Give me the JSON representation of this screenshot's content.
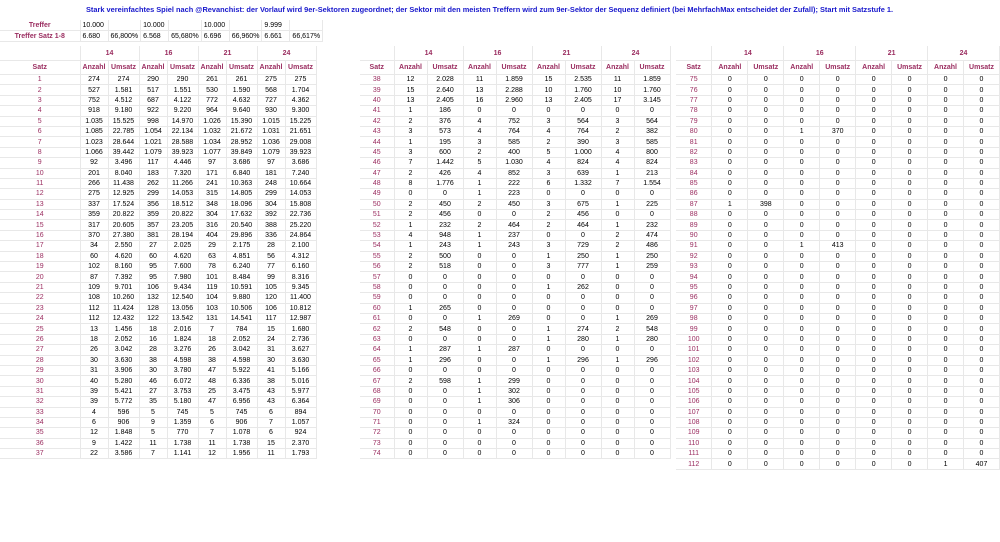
{
  "note": "Stark vereinfachtes Spiel nach @Revanchist: der Vorlauf wird 9er-Sektoren zugeordnet; der Sektor mit den meisten Treffern wird zum 9er-Sektor der Sequenz definiert (bei MehrfachMax entscheidet der Zufall); Start mit Satzstufe 1.",
  "summary": {
    "treffer_label": "Treffer",
    "treffer_satz_label": "Treffer Satz 1-8",
    "treffer": [
      "10.000",
      "",
      "10.000",
      "",
      "10.000",
      "",
      "9.999",
      ""
    ],
    "treffer_satz": [
      "6.680",
      "66,800%",
      "6.568",
      "65,680%",
      "6.696",
      "66,960%",
      "6.661",
      "66,617%"
    ]
  },
  "columns": {
    "sections": [
      "14",
      "16",
      "21",
      "24"
    ],
    "satz": "Satz",
    "anzahl": "Anzahl",
    "umsatz": "Umsatz"
  },
  "block1": [
    [
      "1",
      "274",
      "274",
      "290",
      "290",
      "261",
      "261",
      "275",
      "275"
    ],
    [
      "2",
      "527",
      "1.581",
      "517",
      "1.551",
      "530",
      "1.590",
      "568",
      "1.704"
    ],
    [
      "3",
      "752",
      "4.512",
      "687",
      "4.122",
      "772",
      "4.632",
      "727",
      "4.362"
    ],
    [
      "4",
      "918",
      "9.180",
      "922",
      "9.220",
      "964",
      "9.640",
      "930",
      "9.300"
    ],
    [
      "5",
      "1.035",
      "15.525",
      "998",
      "14.970",
      "1.026",
      "15.390",
      "1.015",
      "15.225"
    ],
    [
      "6",
      "1.085",
      "22.785",
      "1.054",
      "22.134",
      "1.032",
      "21.672",
      "1.031",
      "21.651"
    ],
    [
      "7",
      "1.023",
      "28.644",
      "1.021",
      "28.588",
      "1.034",
      "28.952",
      "1.036",
      "29.008"
    ],
    [
      "8",
      "1.066",
      "39.442",
      "1.079",
      "39.923",
      "1.077",
      "39.849",
      "1.079",
      "39.923"
    ],
    [
      "9",
      "92",
      "3.496",
      "117",
      "4.446",
      "97",
      "3.686",
      "97",
      "3.686"
    ],
    [
      "10",
      "201",
      "8.040",
      "183",
      "7.320",
      "171",
      "6.840",
      "181",
      "7.240"
    ],
    [
      "11",
      "266",
      "11.438",
      "262",
      "11.266",
      "241",
      "10.363",
      "248",
      "10.664"
    ],
    [
      "12",
      "275",
      "12.925",
      "299",
      "14.053",
      "315",
      "14.805",
      "299",
      "14.053"
    ],
    [
      "13",
      "337",
      "17.524",
      "356",
      "18.512",
      "348",
      "18.096",
      "304",
      "15.808"
    ],
    [
      "14",
      "359",
      "20.822",
      "359",
      "20.822",
      "304",
      "17.632",
      "392",
      "22.736"
    ],
    [
      "15",
      "317",
      "20.605",
      "357",
      "23.205",
      "316",
      "20.540",
      "388",
      "25.220"
    ],
    [
      "16",
      "370",
      "27.380",
      "381",
      "28.194",
      "404",
      "29.896",
      "336",
      "24.864"
    ],
    [
      "17",
      "34",
      "2.550",
      "27",
      "2.025",
      "29",
      "2.175",
      "28",
      "2.100"
    ],
    [
      "18",
      "60",
      "4.620",
      "60",
      "4.620",
      "63",
      "4.851",
      "56",
      "4.312"
    ],
    [
      "19",
      "102",
      "8.160",
      "95",
      "7.600",
      "78",
      "6.240",
      "77",
      "6.160"
    ],
    [
      "20",
      "87",
      "7.392",
      "95",
      "7.980",
      "101",
      "8.484",
      "99",
      "8.316"
    ],
    [
      "21",
      "109",
      "9.701",
      "106",
      "9.434",
      "119",
      "10.591",
      "105",
      "9.345"
    ],
    [
      "22",
      "108",
      "10.260",
      "132",
      "12.540",
      "104",
      "9.880",
      "120",
      "11.400"
    ],
    [
      "23",
      "112",
      "11.424",
      "128",
      "13.056",
      "103",
      "10.506",
      "106",
      "10.812"
    ],
    [
      "24",
      "112",
      "12.432",
      "122",
      "13.542",
      "131",
      "14.541",
      "117",
      "12.987"
    ],
    [
      "25",
      "13",
      "1.456",
      "18",
      "2.016",
      "7",
      "784",
      "15",
      "1.680"
    ],
    [
      "26",
      "18",
      "2.052",
      "16",
      "1.824",
      "18",
      "2.052",
      "24",
      "2.736"
    ],
    [
      "27",
      "26",
      "3.042",
      "28",
      "3.276",
      "26",
      "3.042",
      "31",
      "3.627"
    ],
    [
      "28",
      "30",
      "3.630",
      "38",
      "4.598",
      "38",
      "4.598",
      "30",
      "3.630"
    ],
    [
      "29",
      "31",
      "3.906",
      "30",
      "3.780",
      "47",
      "5.922",
      "41",
      "5.166"
    ],
    [
      "30",
      "40",
      "5.280",
      "46",
      "6.072",
      "48",
      "6.336",
      "38",
      "5.016"
    ],
    [
      "31",
      "39",
      "5.421",
      "27",
      "3.753",
      "25",
      "3.475",
      "43",
      "5.977"
    ],
    [
      "32",
      "39",
      "5.772",
      "35",
      "5.180",
      "47",
      "6.956",
      "43",
      "6.364"
    ],
    [
      "33",
      "4",
      "596",
      "5",
      "745",
      "5",
      "745",
      "6",
      "894"
    ],
    [
      "34",
      "6",
      "906",
      "9",
      "1.359",
      "6",
      "906",
      "7",
      "1.057"
    ],
    [
      "35",
      "12",
      "1.848",
      "5",
      "770",
      "7",
      "1.078",
      "6",
      "924"
    ],
    [
      "36",
      "9",
      "1.422",
      "11",
      "1.738",
      "11",
      "1.738",
      "15",
      "2.370"
    ],
    [
      "37",
      "22",
      "3.586",
      "7",
      "1.141",
      "12",
      "1.956",
      "11",
      "1.793"
    ]
  ],
  "block2": [
    [
      "38",
      "12",
      "2.028",
      "11",
      "1.859",
      "15",
      "2.535",
      "11",
      "1.859"
    ],
    [
      "39",
      "15",
      "2.640",
      "13",
      "2.288",
      "10",
      "1.760",
      "10",
      "1.760"
    ],
    [
      "40",
      "13",
      "2.405",
      "16",
      "2.960",
      "13",
      "2.405",
      "17",
      "3.145"
    ],
    [
      "41",
      "1",
      "186",
      "0",
      "0",
      "0",
      "0",
      "0",
      "0"
    ],
    [
      "42",
      "2",
      "376",
      "4",
      "752",
      "3",
      "564",
      "3",
      "564"
    ],
    [
      "43",
      "3",
      "573",
      "4",
      "764",
      "4",
      "764",
      "2",
      "382"
    ],
    [
      "44",
      "1",
      "195",
      "3",
      "585",
      "2",
      "390",
      "3",
      "585"
    ],
    [
      "45",
      "3",
      "600",
      "2",
      "400",
      "5",
      "1.000",
      "4",
      "800"
    ],
    [
      "46",
      "7",
      "1.442",
      "5",
      "1.030",
      "4",
      "824",
      "4",
      "824"
    ],
    [
      "47",
      "2",
      "426",
      "4",
      "852",
      "3",
      "639",
      "1",
      "213"
    ],
    [
      "48",
      "8",
      "1.776",
      "1",
      "222",
      "6",
      "1.332",
      "7",
      "1.554"
    ],
    [
      "49",
      "0",
      "0",
      "1",
      "223",
      "0",
      "0",
      "0",
      "0"
    ],
    [
      "50",
      "2",
      "450",
      "2",
      "450",
      "3",
      "675",
      "1",
      "225"
    ],
    [
      "51",
      "2",
      "456",
      "0",
      "0",
      "2",
      "456",
      "0",
      "0"
    ],
    [
      "52",
      "1",
      "232",
      "2",
      "464",
      "2",
      "464",
      "1",
      "232"
    ],
    [
      "53",
      "4",
      "948",
      "1",
      "237",
      "0",
      "0",
      "2",
      "474"
    ],
    [
      "54",
      "1",
      "243",
      "1",
      "243",
      "3",
      "729",
      "2",
      "486"
    ],
    [
      "55",
      "2",
      "500",
      "0",
      "0",
      "1",
      "250",
      "1",
      "250"
    ],
    [
      "56",
      "2",
      "518",
      "0",
      "0",
      "3",
      "777",
      "1",
      "259"
    ],
    [
      "57",
      "0",
      "0",
      "0",
      "0",
      "0",
      "0",
      "0",
      "0"
    ],
    [
      "58",
      "0",
      "0",
      "0",
      "0",
      "1",
      "262",
      "0",
      "0"
    ],
    [
      "59",
      "0",
      "0",
      "0",
      "0",
      "0",
      "0",
      "0",
      "0"
    ],
    [
      "60",
      "1",
      "265",
      "0",
      "0",
      "0",
      "0",
      "0",
      "0"
    ],
    [
      "61",
      "0",
      "0",
      "1",
      "269",
      "0",
      "0",
      "1",
      "269"
    ],
    [
      "62",
      "2",
      "548",
      "0",
      "0",
      "1",
      "274",
      "2",
      "548"
    ],
    [
      "63",
      "0",
      "0",
      "0",
      "0",
      "1",
      "280",
      "1",
      "280"
    ],
    [
      "64",
      "1",
      "287",
      "1",
      "287",
      "0",
      "0",
      "0",
      "0"
    ],
    [
      "65",
      "1",
      "296",
      "0",
      "0",
      "1",
      "296",
      "1",
      "296"
    ],
    [
      "66",
      "0",
      "0",
      "0",
      "0",
      "0",
      "0",
      "0",
      "0"
    ],
    [
      "67",
      "2",
      "598",
      "1",
      "299",
      "0",
      "0",
      "0",
      "0"
    ],
    [
      "68",
      "0",
      "0",
      "1",
      "302",
      "0",
      "0",
      "0",
      "0"
    ],
    [
      "69",
      "0",
      "0",
      "1",
      "306",
      "0",
      "0",
      "0",
      "0"
    ],
    [
      "70",
      "0",
      "0",
      "0",
      "0",
      "0",
      "0",
      "0",
      "0"
    ],
    [
      "71",
      "0",
      "0",
      "1",
      "324",
      "0",
      "0",
      "0",
      "0"
    ],
    [
      "72",
      "0",
      "0",
      "0",
      "0",
      "0",
      "0",
      "0",
      "0"
    ],
    [
      "73",
      "0",
      "0",
      "0",
      "0",
      "0",
      "0",
      "0",
      "0"
    ],
    [
      "74",
      "0",
      "0",
      "0",
      "0",
      "0",
      "0",
      "0",
      "0"
    ]
  ],
  "block3": [
    [
      "75",
      "0",
      "0",
      "0",
      "0",
      "0",
      "0",
      "0",
      "0"
    ],
    [
      "76",
      "0",
      "0",
      "0",
      "0",
      "0",
      "0",
      "0",
      "0"
    ],
    [
      "77",
      "0",
      "0",
      "0",
      "0",
      "0",
      "0",
      "0",
      "0"
    ],
    [
      "78",
      "0",
      "0",
      "0",
      "0",
      "0",
      "0",
      "0",
      "0"
    ],
    [
      "79",
      "0",
      "0",
      "0",
      "0",
      "0",
      "0",
      "0",
      "0"
    ],
    [
      "80",
      "0",
      "0",
      "1",
      "370",
      "0",
      "0",
      "0",
      "0"
    ],
    [
      "81",
      "0",
      "0",
      "0",
      "0",
      "0",
      "0",
      "0",
      "0"
    ],
    [
      "82",
      "0",
      "0",
      "0",
      "0",
      "0",
      "0",
      "0",
      "0"
    ],
    [
      "83",
      "0",
      "0",
      "0",
      "0",
      "0",
      "0",
      "0",
      "0"
    ],
    [
      "84",
      "0",
      "0",
      "0",
      "0",
      "0",
      "0",
      "0",
      "0"
    ],
    [
      "85",
      "0",
      "0",
      "0",
      "0",
      "0",
      "0",
      "0",
      "0"
    ],
    [
      "86",
      "0",
      "0",
      "0",
      "0",
      "0",
      "0",
      "0",
      "0"
    ],
    [
      "87",
      "1",
      "398",
      "0",
      "0",
      "0",
      "0",
      "0",
      "0"
    ],
    [
      "88",
      "0",
      "0",
      "0",
      "0",
      "0",
      "0",
      "0",
      "0"
    ],
    [
      "89",
      "0",
      "0",
      "0",
      "0",
      "0",
      "0",
      "0",
      "0"
    ],
    [
      "90",
      "0",
      "0",
      "0",
      "0",
      "0",
      "0",
      "0",
      "0"
    ],
    [
      "91",
      "0",
      "0",
      "1",
      "413",
      "0",
      "0",
      "0",
      "0"
    ],
    [
      "92",
      "0",
      "0",
      "0",
      "0",
      "0",
      "0",
      "0",
      "0"
    ],
    [
      "93",
      "0",
      "0",
      "0",
      "0",
      "0",
      "0",
      "0",
      "0"
    ],
    [
      "94",
      "0",
      "0",
      "0",
      "0",
      "0",
      "0",
      "0",
      "0"
    ],
    [
      "95",
      "0",
      "0",
      "0",
      "0",
      "0",
      "0",
      "0",
      "0"
    ],
    [
      "96",
      "0",
      "0",
      "0",
      "0",
      "0",
      "0",
      "0",
      "0"
    ],
    [
      "97",
      "0",
      "0",
      "0",
      "0",
      "0",
      "0",
      "0",
      "0"
    ],
    [
      "98",
      "0",
      "0",
      "0",
      "0",
      "0",
      "0",
      "0",
      "0"
    ],
    [
      "99",
      "0",
      "0",
      "0",
      "0",
      "0",
      "0",
      "0",
      "0"
    ],
    [
      "100",
      "0",
      "0",
      "0",
      "0",
      "0",
      "0",
      "0",
      "0"
    ],
    [
      "101",
      "0",
      "0",
      "0",
      "0",
      "0",
      "0",
      "0",
      "0"
    ],
    [
      "102",
      "0",
      "0",
      "0",
      "0",
      "0",
      "0",
      "0",
      "0"
    ],
    [
      "103",
      "0",
      "0",
      "0",
      "0",
      "0",
      "0",
      "0",
      "0"
    ],
    [
      "104",
      "0",
      "0",
      "0",
      "0",
      "0",
      "0",
      "0",
      "0"
    ],
    [
      "105",
      "0",
      "0",
      "0",
      "0",
      "0",
      "0",
      "0",
      "0"
    ],
    [
      "106",
      "0",
      "0",
      "0",
      "0",
      "0",
      "0",
      "0",
      "0"
    ],
    [
      "107",
      "0",
      "0",
      "0",
      "0",
      "0",
      "0",
      "0",
      "0"
    ],
    [
      "108",
      "0",
      "0",
      "0",
      "0",
      "0",
      "0",
      "0",
      "0"
    ],
    [
      "109",
      "0",
      "0",
      "0",
      "0",
      "0",
      "0",
      "0",
      "0"
    ],
    [
      "110",
      "0",
      "0",
      "0",
      "0",
      "0",
      "0",
      "0",
      "0"
    ],
    [
      "111",
      "0",
      "0",
      "0",
      "0",
      "0",
      "0",
      "0",
      "0"
    ],
    [
      "112",
      "0",
      "0",
      "0",
      "0",
      "0",
      "0",
      "1",
      "407"
    ]
  ]
}
